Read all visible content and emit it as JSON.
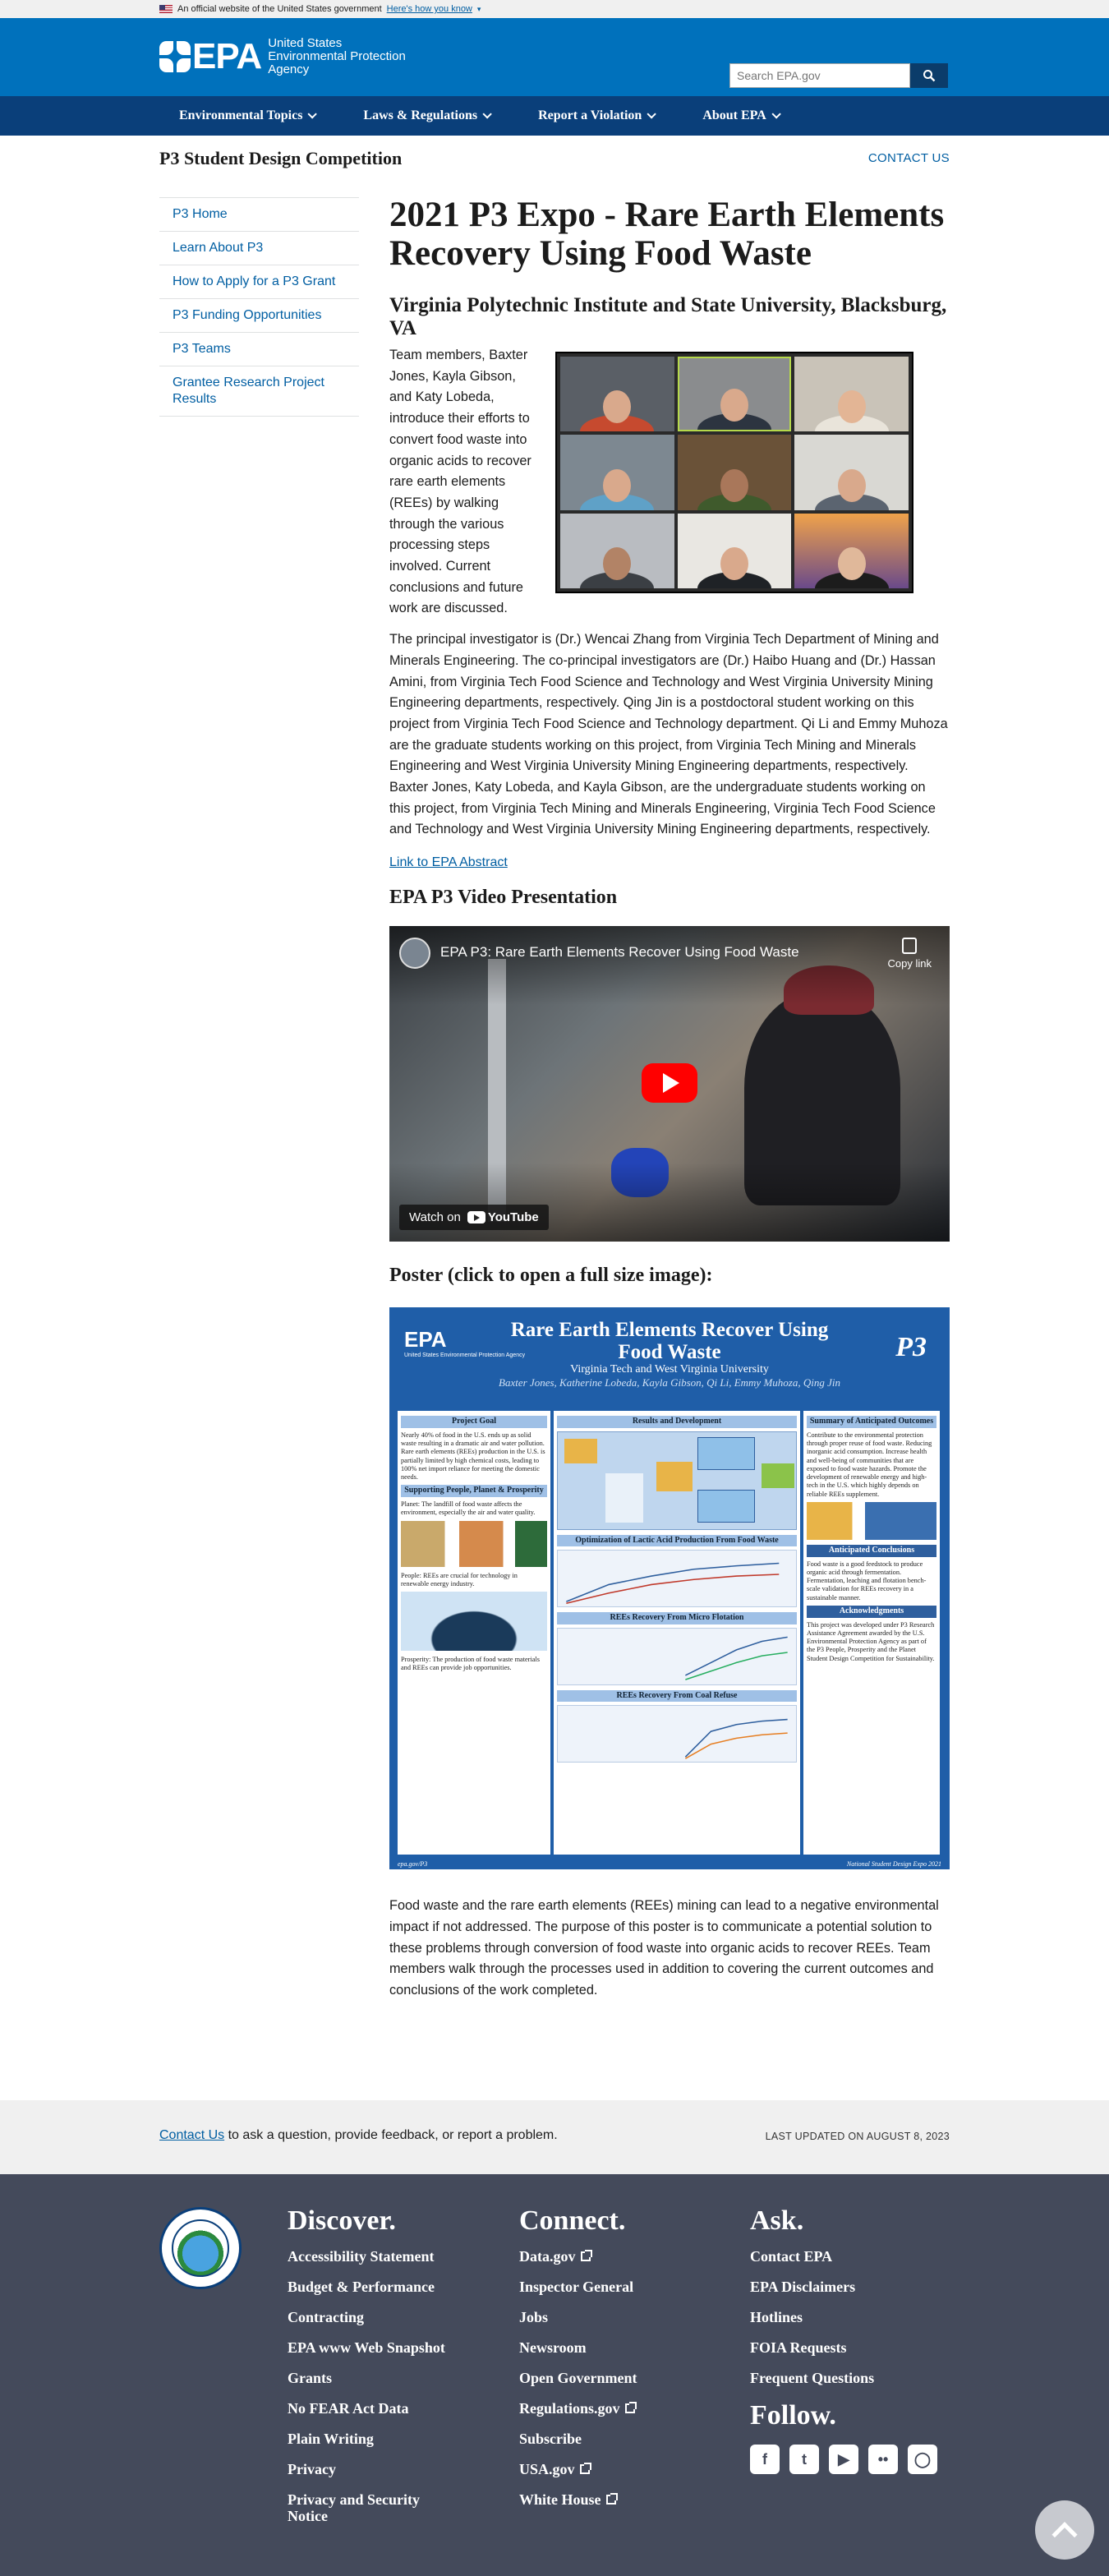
{
  "gov_banner": {
    "text": "An official website of the United States government",
    "link": "Here's how you know"
  },
  "header": {
    "logo_abbr": "EPA",
    "agency_name_1": "United States",
    "agency_name_2": "Environmental Protection",
    "agency_name_3": "Agency",
    "search_placeholder": "Search EPA.gov",
    "brand_color": "#0071bc"
  },
  "nav": {
    "items": [
      "Environmental Topics",
      "Laws & Regulations",
      "Report a Violation",
      "About EPA"
    ]
  },
  "site": {
    "title": "P3 Student Design Competition",
    "contact": "CONTACT US"
  },
  "sidebar": {
    "items": [
      "P3 Home",
      "Learn About P3",
      "How to Apply for a P3 Grant",
      "P3 Funding Opportunities",
      "P3 Teams",
      "Grantee Research Project Results"
    ]
  },
  "main": {
    "title": "2021 P3 Expo - Rare Earth Elements Recovery Using Food Waste",
    "subtitle": "Virginia Polytechnic Institute and State University, Blacksburg, VA",
    "intro": "Team members, Baxter Jones, Kayla Gibson, and Katy Lobeda, introduce their efforts to convert food waste into organic acids to recover rare earth elements (REEs) by walking through the various processing steps involved. Current conclusions and future work are discussed.",
    "paragraph": "The principal investigator is (Dr.) Wencai Zhang from Virginia Tech Department of Mining and Minerals Engineering. The co-principal investigators are (Dr.) Haibo Huang and (Dr.) Hassan Amini, from Virginia Tech Food Science and Technology and West Virginia University Mining Engineering departments, respectively. Qing Jin is a postdoctoral student working on this project from Virginia Tech Food Science and Technology department. Qi Li and Emmy Muhoza are the graduate students working on this project, from Virginia Tech Mining and Minerals Engineering and West Virginia University Mining Engineering departments, respectively. Baxter Jones, Katy Lobeda, and Kayla Gibson, are the undergraduate students working on this project, from Virginia Tech Mining and Minerals Engineering, Virginia Tech Food Science and Technology and West Virginia University Mining Engineering departments, respectively.",
    "abstract_link": "Link to EPA Abstract",
    "video_heading": "EPA P3 Video Presentation",
    "video": {
      "title": "EPA P3: Rare Earth Elements Recover Using Food Waste",
      "copy_link": "Copy link",
      "watch_on": "Watch on",
      "youtube": "YouTube"
    },
    "poster_heading": "Poster (click to open a full size image):",
    "poster": {
      "title_1": "Rare Earth Elements Recover Using",
      "title_2": "Food Waste",
      "university": "Virginia Tech and West Virginia University",
      "authors": "Baxter Jones, Katherine Lobeda, Kayla Gibson, Qi Li, Emmy Muhoza, Qing Jin",
      "epa": "EPA",
      "epa_sub": "United States Environmental Protection Agency",
      "p3": "P3",
      "project_goal": "Project Goal",
      "results": "Results and Development",
      "summary": "Summary of Anticipated Outcomes",
      "supporting": "Supporting People, Planet & Prosperity",
      "conclusions": "Anticipated Conclusions",
      "acknowledgments": "Acknowledgments",
      "chart_1": "Optimization of Lactic Acid Production From Food Waste",
      "chart_2": "REEs Recovery From Micro Flotation",
      "chart_3": "REEs Recovery From Coal Refuse",
      "goal_text": "Nearly 40% of food in the U.S. ends up as solid waste resulting in a dramatic air and water pollution. Rare earth elements (REEs) production in the U.S. is partially limited by high chemical costs, leading to 100% net import reliance for meeting the domestic needs.",
      "planet_text": "Planet: The landfill of food waste affects the environment, especially the air and water quality.",
      "people_text": "People: REEs are crucial for technology in renewable energy industry.",
      "prosperity_text": "Prosperity: The production of food waste materials and REEs can provide job opportunities.",
      "summary_text": "Contribute to the environmental protection through proper reuse of food waste. Reducing inorganic acid consumption. Increase health and well-being of communities that are exposed to food waste hazards. Promote the development of renewable energy and high-tech in the U.S. which highly depends on reliable REEs supplement.",
      "conclusions_text": "Food waste is a good feedstock to produce organic acid through fermentation. Fermentation, leaching and flotation bench-scale validation for REEs recovery in a sustainable manner.",
      "ack_text": "This project was developed under P3 Research Assistance Agreement awarded by the U.S. Environmental Protection Agency as part of the P3 People, Prosperity and the Planet Student Design Competition for Sustainability.",
      "footer_left": "epa.gov/P3",
      "footer_right": "National Student Design Expo 2021"
    },
    "summary": "Food waste and the rare earth elements (REEs) mining can lead to a negative environmental impact if not addressed. The purpose of this poster is to communicate a potential solution to these problems through conversion of food waste into organic acids to recover REEs. Team members walk through the processes used in addition to covering the current outcomes and conclusions of the work completed."
  },
  "contact_bar": {
    "link": "Contact Us",
    "text": " to ask a question, provide feedback, or report a problem.",
    "updated": "LAST UPDATED ON AUGUST 8, 2023"
  },
  "footer": {
    "discover": {
      "heading": "Discover.",
      "items": [
        "Accessibility Statement",
        "Budget & Performance",
        "Contracting",
        "EPA www Web Snapshot",
        "Grants",
        "No FEAR Act Data",
        "Plain Writing",
        "Privacy",
        "Privacy and Security Notice"
      ]
    },
    "connect": {
      "heading": "Connect.",
      "items": [
        "Data.gov",
        "Inspector General",
        "Jobs",
        "Newsroom",
        "Open Government",
        "Regulations.gov",
        "Subscribe",
        "USA.gov",
        "White House"
      ]
    },
    "ask": {
      "heading": "Ask.",
      "items": [
        "Contact EPA",
        "EPA Disclaimers",
        "Hotlines",
        "FOIA Requests",
        "Frequent Questions"
      ]
    },
    "follow": {
      "heading": "Follow.",
      "social": [
        "facebook-icon",
        "twitter-icon",
        "youtube-icon",
        "flickr-icon",
        "instagram-icon"
      ]
    },
    "bg_color": "#444a5b"
  }
}
